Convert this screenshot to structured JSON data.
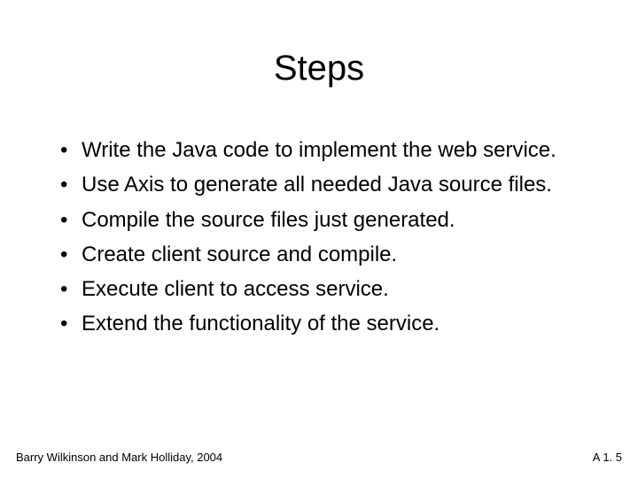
{
  "title": "Steps",
  "bullets": [
    "Write the Java code to implement the web service.",
    "Use Axis to generate all needed Java source files.",
    "Compile the source files just generated.",
    "Create client source and compile.",
    "Execute client to access service.",
    "Extend the functionality of the service."
  ],
  "footer": {
    "left": "Barry Wilkinson and Mark Holliday, 2004",
    "right": "A 1. 5"
  }
}
